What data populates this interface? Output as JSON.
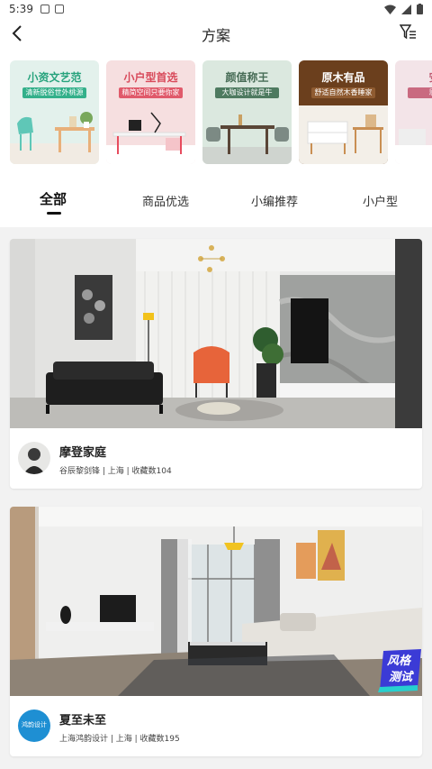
{
  "status_bar": {
    "time": "5:39"
  },
  "header": {
    "title": "方案"
  },
  "banners": [
    {
      "title": "小资文艺范",
      "subtitle": "清新脱俗世外桃源",
      "bg": "#e3f1ec",
      "title_color": "#27a37d",
      "sub_bg": "#33b08a"
    },
    {
      "title": "小户型首选",
      "subtitle": "精简空间只要你家",
      "bg": "#f6dfe0",
      "title_color": "#d8495a",
      "sub_bg": "#e05a6b"
    },
    {
      "title": "颜值称王",
      "subtitle": "大咖设计就是牛",
      "bg": "#dbe8df",
      "title_color": "#476c56",
      "sub_bg": "#4e7a60"
    },
    {
      "title": "原木有品",
      "subtitle": "舒适自然木香睡家",
      "bg": "#6b3f1d",
      "title_color": "#ffffff",
      "sub_bg": "#8f5b31"
    },
    {
      "title": "安静",
      "subtitle": "恩乌者",
      "bg": "#f3e4e8",
      "title_color": "#c0576e",
      "sub_bg": "#c96a80"
    }
  ],
  "tabs": [
    "全部",
    "商品优选",
    "小编推荐",
    "小户型"
  ],
  "cards": [
    {
      "title": "摩登家庭",
      "meta": "谷辰黎剑锋 | 上海 | 收藏数104"
    },
    {
      "title": "夏至未至",
      "meta": "上海鸿韵设计 | 上海 | 收藏数195",
      "logo_text": "鸿韵设计"
    }
  ],
  "badge": {
    "line1": "风格",
    "line2": "测试"
  }
}
